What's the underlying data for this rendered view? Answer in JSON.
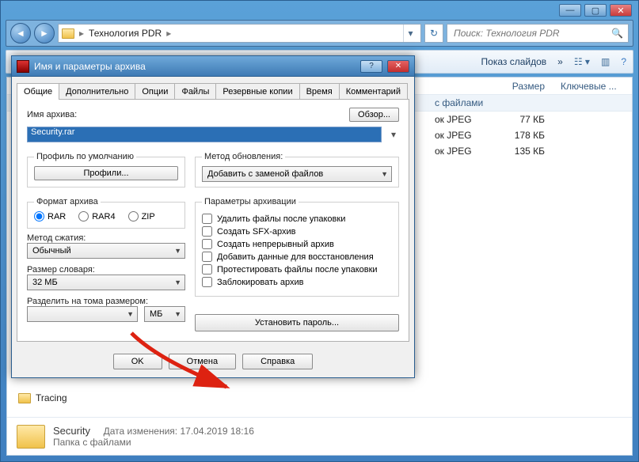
{
  "explorer": {
    "breadcrumb_item": "Технология PDR",
    "search_placeholder": "Поиск: Технология PDR",
    "toolbar_slideshow": "Показ слайдов",
    "toolbar_more": "»",
    "columns": {
      "size": "Размер",
      "keys": "Ключевые ..."
    },
    "group_header": "с файлами",
    "files": [
      {
        "type": "ок JPEG",
        "size": "77 КБ"
      },
      {
        "type": "ок JPEG",
        "size": "178 КБ"
      },
      {
        "type": "ок JPEG",
        "size": "135 КБ"
      }
    ],
    "tree_item": "Tracing",
    "details": {
      "name": "Security",
      "date_label": "Дата изменения:",
      "date_value": "17.04.2019 18:16",
      "kind": "Папка с файлами"
    }
  },
  "dialog": {
    "title": "Имя и параметры архива",
    "tabs": [
      "Общие",
      "Дополнительно",
      "Опции",
      "Файлы",
      "Резервные копии",
      "Время",
      "Комментарий"
    ],
    "archive_name_label": "Имя архива:",
    "browse_btn": "Обзор...",
    "archive_name_value": "Security.rar",
    "profile_legend": "Профиль по умолчанию",
    "profiles_btn": "Профили...",
    "update_legend": "Метод обновления:",
    "update_value": "Добавить с заменой файлов",
    "format_legend": "Формат архива",
    "formats": [
      "RAR",
      "RAR4",
      "ZIP"
    ],
    "compress_label": "Метод сжатия:",
    "compress_value": "Обычный",
    "dict_label": "Размер словаря:",
    "dict_value": "32 МБ",
    "split_label": "Разделить на тома размером:",
    "split_unit": "МБ",
    "params_legend": "Параметры архивации",
    "params": [
      "Удалить файлы после упаковки",
      "Создать SFX-архив",
      "Создать непрерывный архив",
      "Добавить данные для восстановления",
      "Протестировать файлы после упаковки",
      "Заблокировать архив"
    ],
    "password_btn": "Установить пароль...",
    "ok": "OK",
    "cancel": "Отмена",
    "help": "Справка"
  }
}
